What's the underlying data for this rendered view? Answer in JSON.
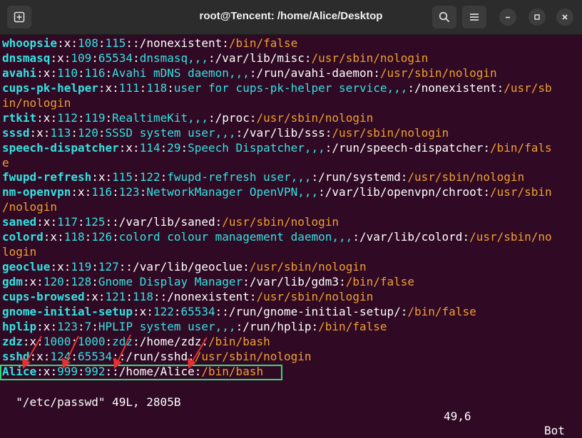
{
  "window": {
    "title": "root@Tencent: /home/Alice/Desktop",
    "new_tab_icon": "new-tab-icon",
    "search_icon": "search-icon",
    "menu_icon": "hamburger-menu-icon"
  },
  "lines": [
    [
      {
        "t": "whoopsie",
        "c": "u"
      },
      {
        "t": ":x:",
        "c": "w"
      },
      {
        "t": "108",
        "c": "d"
      },
      {
        "t": ":",
        "c": "w"
      },
      {
        "t": "115",
        "c": "d"
      },
      {
        "t": "::/nonexistent:",
        "c": "w"
      },
      {
        "t": "/bin/false",
        "c": "p"
      }
    ],
    [
      {
        "t": "dnsmasq",
        "c": "u"
      },
      {
        "t": ":x:",
        "c": "w"
      },
      {
        "t": "109",
        "c": "d"
      },
      {
        "t": ":",
        "c": "w"
      },
      {
        "t": "65534",
        "c": "d"
      },
      {
        "t": ":",
        "c": "w"
      },
      {
        "t": "dnsmasq,,,",
        "c": "d"
      },
      {
        "t": ":/var/lib/misc:",
        "c": "w"
      },
      {
        "t": "/usr/sbin/nologin",
        "c": "p"
      }
    ],
    [
      {
        "t": "avahi",
        "c": "u"
      },
      {
        "t": ":x:",
        "c": "w"
      },
      {
        "t": "110",
        "c": "d"
      },
      {
        "t": ":",
        "c": "w"
      },
      {
        "t": "116",
        "c": "d"
      },
      {
        "t": ":",
        "c": "w"
      },
      {
        "t": "Avahi mDNS daemon,,,",
        "c": "d"
      },
      {
        "t": ":/run/avahi-daemon:",
        "c": "w"
      },
      {
        "t": "/usr/sbin/nologin",
        "c": "p"
      }
    ],
    [
      {
        "t": "cups-pk-helper",
        "c": "u"
      },
      {
        "t": ":x:",
        "c": "w"
      },
      {
        "t": "111",
        "c": "d"
      },
      {
        "t": ":",
        "c": "w"
      },
      {
        "t": "118",
        "c": "d"
      },
      {
        "t": ":",
        "c": "w"
      },
      {
        "t": "user for cups-pk-helper service,,,",
        "c": "d"
      },
      {
        "t": ":/nonexistent:",
        "c": "w"
      },
      {
        "t": "/usr/sb",
        "c": "p"
      }
    ],
    [
      {
        "t": "in/nologin",
        "c": "p"
      }
    ],
    [
      {
        "t": "rtkit",
        "c": "u"
      },
      {
        "t": ":x:",
        "c": "w"
      },
      {
        "t": "112",
        "c": "d"
      },
      {
        "t": ":",
        "c": "w"
      },
      {
        "t": "119",
        "c": "d"
      },
      {
        "t": ":",
        "c": "w"
      },
      {
        "t": "RealtimeKit,,,",
        "c": "d"
      },
      {
        "t": ":/proc:",
        "c": "w"
      },
      {
        "t": "/usr/sbin/nologin",
        "c": "p"
      }
    ],
    [
      {
        "t": "sssd",
        "c": "u"
      },
      {
        "t": ":x:",
        "c": "w"
      },
      {
        "t": "113",
        "c": "d"
      },
      {
        "t": ":",
        "c": "w"
      },
      {
        "t": "120",
        "c": "d"
      },
      {
        "t": ":",
        "c": "w"
      },
      {
        "t": "SSSD system user,,,",
        "c": "d"
      },
      {
        "t": ":/var/lib/sss:",
        "c": "w"
      },
      {
        "t": "/usr/sbin/nologin",
        "c": "p"
      }
    ],
    [
      {
        "t": "speech-dispatcher",
        "c": "u"
      },
      {
        "t": ":x:",
        "c": "w"
      },
      {
        "t": "114",
        "c": "d"
      },
      {
        "t": ":",
        "c": "w"
      },
      {
        "t": "29",
        "c": "d"
      },
      {
        "t": ":",
        "c": "w"
      },
      {
        "t": "Speech Dispatcher,,,",
        "c": "d"
      },
      {
        "t": ":/run/speech-dispatcher:",
        "c": "w"
      },
      {
        "t": "/bin/fals",
        "c": "p"
      }
    ],
    [
      {
        "t": "e",
        "c": "p"
      }
    ],
    [
      {
        "t": "fwupd-refresh",
        "c": "u"
      },
      {
        "t": ":x:",
        "c": "w"
      },
      {
        "t": "115",
        "c": "d"
      },
      {
        "t": ":",
        "c": "w"
      },
      {
        "t": "122",
        "c": "d"
      },
      {
        "t": ":",
        "c": "w"
      },
      {
        "t": "fwupd-refresh user,,,",
        "c": "d"
      },
      {
        "t": ":/run/systemd:",
        "c": "w"
      },
      {
        "t": "/usr/sbin/nologin",
        "c": "p"
      }
    ],
    [
      {
        "t": "nm-openvpn",
        "c": "u"
      },
      {
        "t": ":x:",
        "c": "w"
      },
      {
        "t": "116",
        "c": "d"
      },
      {
        "t": ":",
        "c": "w"
      },
      {
        "t": "123",
        "c": "d"
      },
      {
        "t": ":",
        "c": "w"
      },
      {
        "t": "NetworkManager OpenVPN,,,",
        "c": "d"
      },
      {
        "t": ":/var/lib/openvpn/chroot:",
        "c": "w"
      },
      {
        "t": "/usr/sbin",
        "c": "p"
      }
    ],
    [
      {
        "t": "/nologin",
        "c": "p"
      }
    ],
    [
      {
        "t": "saned",
        "c": "u"
      },
      {
        "t": ":x:",
        "c": "w"
      },
      {
        "t": "117",
        "c": "d"
      },
      {
        "t": ":",
        "c": "w"
      },
      {
        "t": "125",
        "c": "d"
      },
      {
        "t": "::/var/lib/saned:",
        "c": "w"
      },
      {
        "t": "/usr/sbin/nologin",
        "c": "p"
      }
    ],
    [
      {
        "t": "colord",
        "c": "u"
      },
      {
        "t": ":x:",
        "c": "w"
      },
      {
        "t": "118",
        "c": "d"
      },
      {
        "t": ":",
        "c": "w"
      },
      {
        "t": "126",
        "c": "d"
      },
      {
        "t": ":",
        "c": "w"
      },
      {
        "t": "colord colour management daemon,,,",
        "c": "d"
      },
      {
        "t": ":/var/lib/colord:",
        "c": "w"
      },
      {
        "t": "/usr/sbin/no",
        "c": "p"
      }
    ],
    [
      {
        "t": "login",
        "c": "p"
      }
    ],
    [
      {
        "t": "geoclue",
        "c": "u"
      },
      {
        "t": ":x:",
        "c": "w"
      },
      {
        "t": "119",
        "c": "d"
      },
      {
        "t": ":",
        "c": "w"
      },
      {
        "t": "127",
        "c": "d"
      },
      {
        "t": "::/var/lib/geoclue:",
        "c": "w"
      },
      {
        "t": "/usr/sbin/nologin",
        "c": "p"
      }
    ],
    [
      {
        "t": "gdm",
        "c": "u"
      },
      {
        "t": ":x:",
        "c": "w"
      },
      {
        "t": "120",
        "c": "d"
      },
      {
        "t": ":",
        "c": "w"
      },
      {
        "t": "128",
        "c": "d"
      },
      {
        "t": ":",
        "c": "w"
      },
      {
        "t": "Gnome Display Manager",
        "c": "d"
      },
      {
        "t": ":/var/lib/gdm3:",
        "c": "w"
      },
      {
        "t": "/bin/false",
        "c": "p"
      }
    ],
    [
      {
        "t": "cups-browsed",
        "c": "u"
      },
      {
        "t": ":x:",
        "c": "w"
      },
      {
        "t": "121",
        "c": "d"
      },
      {
        "t": ":",
        "c": "w"
      },
      {
        "t": "118",
        "c": "d"
      },
      {
        "t": "::/nonexistent:",
        "c": "w"
      },
      {
        "t": "/usr/sbin/nologin",
        "c": "p"
      }
    ],
    [
      {
        "t": "gnome-initial-setup",
        "c": "u"
      },
      {
        "t": ":x:",
        "c": "w"
      },
      {
        "t": "122",
        "c": "d"
      },
      {
        "t": ":",
        "c": "w"
      },
      {
        "t": "65534",
        "c": "d"
      },
      {
        "t": "::/run/gnome-initial-setup/:",
        "c": "w"
      },
      {
        "t": "/bin/false",
        "c": "p"
      }
    ],
    [
      {
        "t": "hplip",
        "c": "u"
      },
      {
        "t": ":x:",
        "c": "w"
      },
      {
        "t": "123",
        "c": "d"
      },
      {
        "t": ":",
        "c": "w"
      },
      {
        "t": "7",
        "c": "d"
      },
      {
        "t": ":",
        "c": "w"
      },
      {
        "t": "HPLIP system user,,,",
        "c": "d"
      },
      {
        "t": ":/run/hplip:",
        "c": "w"
      },
      {
        "t": "/bin/false",
        "c": "p"
      }
    ],
    [
      {
        "t": "zdz",
        "c": "u"
      },
      {
        "t": ":x:",
        "c": "w"
      },
      {
        "t": "1000",
        "c": "d"
      },
      {
        "t": ":",
        "c": "w"
      },
      {
        "t": "1000",
        "c": "d"
      },
      {
        "t": ":",
        "c": "w"
      },
      {
        "t": "zdz",
        "c": "d"
      },
      {
        "t": ":/home/zdz:",
        "c": "w"
      },
      {
        "t": "/bin/bash",
        "c": "p"
      }
    ],
    [
      {
        "t": "sshd",
        "c": "u"
      },
      {
        "t": ":x:",
        "c": "w"
      },
      {
        "t": "124",
        "c": "d"
      },
      {
        "t": ":",
        "c": "w"
      },
      {
        "t": "65534",
        "c": "d"
      },
      {
        "t": "::/run/sshd:",
        "c": "w"
      },
      {
        "t": "/usr/sbin/nologin",
        "c": "p"
      }
    ],
    [
      {
        "t": "Alice",
        "c": "u"
      },
      {
        "t": ":x:",
        "c": "w"
      },
      {
        "t": "999",
        "c": "d"
      },
      {
        "t": ":",
        "c": "w"
      },
      {
        "t": "992",
        "c": "d"
      },
      {
        "t": "::/home/Alice:",
        "c": "w"
      },
      {
        "t": "/bin/bash",
        "c": "p"
      }
    ]
  ],
  "status": {
    "file": "\"/etc/passwd\" 49L, 2805B",
    "position": "49,6",
    "scroll": "Bot"
  },
  "colors": {
    "background": "#300a24",
    "username": "#34e2e2",
    "path": "#f0a030",
    "annotation_box": "#37d67a",
    "annotation_arrow": "#e83030"
  }
}
